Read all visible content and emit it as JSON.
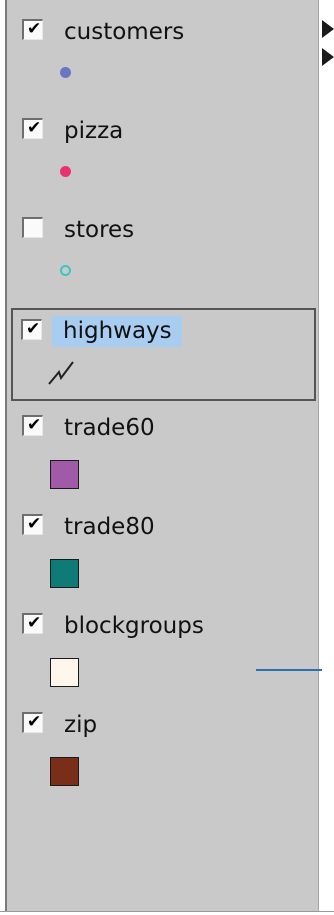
{
  "layers": [
    {
      "name": "customers",
      "checked": true,
      "symbol": {
        "kind": "point",
        "fill": "#6677c4",
        "outline": "#6677c4"
      }
    },
    {
      "name": "pizza",
      "checked": true,
      "symbol": {
        "kind": "point",
        "fill": "#e8336f",
        "outline": "#e8336f"
      }
    },
    {
      "name": "stores",
      "checked": false,
      "symbol": {
        "kind": "point",
        "fill": "transparent",
        "outline": "#3cc6c0"
      }
    },
    {
      "name": "highways",
      "checked": true,
      "selected": true,
      "symbol": {
        "kind": "line",
        "stroke": "#222222"
      }
    },
    {
      "name": "trade60",
      "checked": true,
      "symbol": {
        "kind": "polygon",
        "fill": "#a15aa8"
      }
    },
    {
      "name": "trade80",
      "checked": true,
      "symbol": {
        "kind": "polygon",
        "fill": "#0e7b76"
      }
    },
    {
      "name": "blockgroups",
      "checked": true,
      "symbol": {
        "kind": "polygon",
        "fill": "#fff6ec"
      }
    },
    {
      "name": "zip",
      "checked": true,
      "symbol": {
        "kind": "polygon",
        "fill": "#7a2e1a"
      }
    }
  ],
  "check_glyph": "✔",
  "colors": {
    "panel_background": "#c9c9c9",
    "selection_highlight": "#a9cdf0",
    "map_feature_line": "#2a6fb3"
  }
}
